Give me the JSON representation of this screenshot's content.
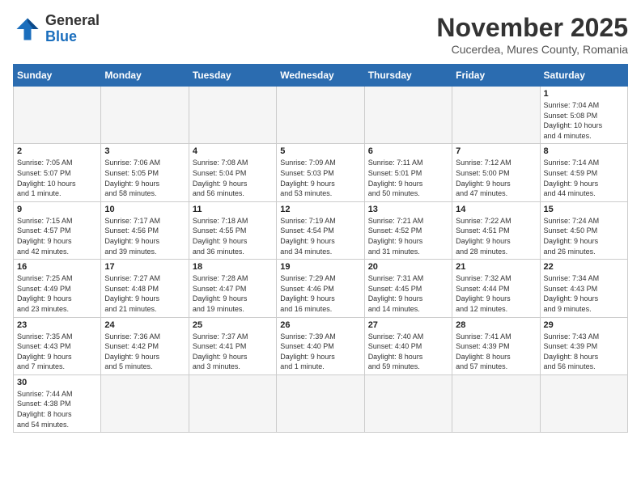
{
  "logo": {
    "line1": "General",
    "line2": "Blue"
  },
  "header": {
    "title": "November 2025",
    "subtitle": "Cucerdea, Mures County, Romania"
  },
  "weekdays": [
    "Sunday",
    "Monday",
    "Tuesday",
    "Wednesday",
    "Thursday",
    "Friday",
    "Saturday"
  ],
  "weeks": [
    [
      {
        "day": "",
        "info": ""
      },
      {
        "day": "",
        "info": ""
      },
      {
        "day": "",
        "info": ""
      },
      {
        "day": "",
        "info": ""
      },
      {
        "day": "",
        "info": ""
      },
      {
        "day": "",
        "info": ""
      },
      {
        "day": "1",
        "info": "Sunrise: 7:04 AM\nSunset: 5:08 PM\nDaylight: 10 hours\nand 4 minutes."
      }
    ],
    [
      {
        "day": "2",
        "info": "Sunrise: 7:05 AM\nSunset: 5:07 PM\nDaylight: 10 hours\nand 1 minute."
      },
      {
        "day": "3",
        "info": "Sunrise: 7:06 AM\nSunset: 5:05 PM\nDaylight: 9 hours\nand 58 minutes."
      },
      {
        "day": "4",
        "info": "Sunrise: 7:08 AM\nSunset: 5:04 PM\nDaylight: 9 hours\nand 56 minutes."
      },
      {
        "day": "5",
        "info": "Sunrise: 7:09 AM\nSunset: 5:03 PM\nDaylight: 9 hours\nand 53 minutes."
      },
      {
        "day": "6",
        "info": "Sunrise: 7:11 AM\nSunset: 5:01 PM\nDaylight: 9 hours\nand 50 minutes."
      },
      {
        "day": "7",
        "info": "Sunrise: 7:12 AM\nSunset: 5:00 PM\nDaylight: 9 hours\nand 47 minutes."
      },
      {
        "day": "8",
        "info": "Sunrise: 7:14 AM\nSunset: 4:59 PM\nDaylight: 9 hours\nand 44 minutes."
      }
    ],
    [
      {
        "day": "9",
        "info": "Sunrise: 7:15 AM\nSunset: 4:57 PM\nDaylight: 9 hours\nand 42 minutes."
      },
      {
        "day": "10",
        "info": "Sunrise: 7:17 AM\nSunset: 4:56 PM\nDaylight: 9 hours\nand 39 minutes."
      },
      {
        "day": "11",
        "info": "Sunrise: 7:18 AM\nSunset: 4:55 PM\nDaylight: 9 hours\nand 36 minutes."
      },
      {
        "day": "12",
        "info": "Sunrise: 7:19 AM\nSunset: 4:54 PM\nDaylight: 9 hours\nand 34 minutes."
      },
      {
        "day": "13",
        "info": "Sunrise: 7:21 AM\nSunset: 4:52 PM\nDaylight: 9 hours\nand 31 minutes."
      },
      {
        "day": "14",
        "info": "Sunrise: 7:22 AM\nSunset: 4:51 PM\nDaylight: 9 hours\nand 28 minutes."
      },
      {
        "day": "15",
        "info": "Sunrise: 7:24 AM\nSunset: 4:50 PM\nDaylight: 9 hours\nand 26 minutes."
      }
    ],
    [
      {
        "day": "16",
        "info": "Sunrise: 7:25 AM\nSunset: 4:49 PM\nDaylight: 9 hours\nand 23 minutes."
      },
      {
        "day": "17",
        "info": "Sunrise: 7:27 AM\nSunset: 4:48 PM\nDaylight: 9 hours\nand 21 minutes."
      },
      {
        "day": "18",
        "info": "Sunrise: 7:28 AM\nSunset: 4:47 PM\nDaylight: 9 hours\nand 19 minutes."
      },
      {
        "day": "19",
        "info": "Sunrise: 7:29 AM\nSunset: 4:46 PM\nDaylight: 9 hours\nand 16 minutes."
      },
      {
        "day": "20",
        "info": "Sunrise: 7:31 AM\nSunset: 4:45 PM\nDaylight: 9 hours\nand 14 minutes."
      },
      {
        "day": "21",
        "info": "Sunrise: 7:32 AM\nSunset: 4:44 PM\nDaylight: 9 hours\nand 12 minutes."
      },
      {
        "day": "22",
        "info": "Sunrise: 7:34 AM\nSunset: 4:43 PM\nDaylight: 9 hours\nand 9 minutes."
      }
    ],
    [
      {
        "day": "23",
        "info": "Sunrise: 7:35 AM\nSunset: 4:43 PM\nDaylight: 9 hours\nand 7 minutes."
      },
      {
        "day": "24",
        "info": "Sunrise: 7:36 AM\nSunset: 4:42 PM\nDaylight: 9 hours\nand 5 minutes."
      },
      {
        "day": "25",
        "info": "Sunrise: 7:37 AM\nSunset: 4:41 PM\nDaylight: 9 hours\nand 3 minutes."
      },
      {
        "day": "26",
        "info": "Sunrise: 7:39 AM\nSunset: 4:40 PM\nDaylight: 9 hours\nand 1 minute."
      },
      {
        "day": "27",
        "info": "Sunrise: 7:40 AM\nSunset: 4:40 PM\nDaylight: 8 hours\nand 59 minutes."
      },
      {
        "day": "28",
        "info": "Sunrise: 7:41 AM\nSunset: 4:39 PM\nDaylight: 8 hours\nand 57 minutes."
      },
      {
        "day": "29",
        "info": "Sunrise: 7:43 AM\nSunset: 4:39 PM\nDaylight: 8 hours\nand 56 minutes."
      }
    ],
    [
      {
        "day": "30",
        "info": "Sunrise: 7:44 AM\nSunset: 4:38 PM\nDaylight: 8 hours\nand 54 minutes."
      },
      {
        "day": "",
        "info": ""
      },
      {
        "day": "",
        "info": ""
      },
      {
        "day": "",
        "info": ""
      },
      {
        "day": "",
        "info": ""
      },
      {
        "day": "",
        "info": ""
      },
      {
        "day": "",
        "info": ""
      }
    ]
  ]
}
